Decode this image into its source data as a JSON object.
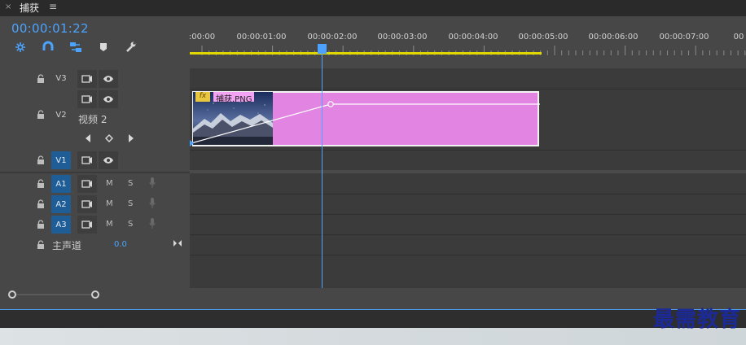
{
  "tab": {
    "close_glyph": "×",
    "title": "捕获",
    "menu_glyph": "≡"
  },
  "timecode": "00:00:01:22",
  "tools": [
    {
      "name": "insert-nest-icon"
    },
    {
      "name": "snap-icon"
    },
    {
      "name": "linked-selection-icon"
    },
    {
      "name": "add-marker-icon"
    },
    {
      "name": "wrench-settings-icon"
    }
  ],
  "ruler": {
    "labels": [
      ":00:00",
      "00:00:01:00",
      "00:00:02:00",
      "00:00:03:00",
      "00:00:04:00",
      "00:00:05:00",
      "00:00:06:00",
      "00:00:07:00",
      "00"
    ]
  },
  "tracks": {
    "v3": {
      "name": "V3"
    },
    "v2": {
      "name": "V2",
      "label": "视频 2"
    },
    "v1": {
      "name": "V1"
    },
    "a1": {
      "name": "A1",
      "m": "M",
      "s": "S"
    },
    "a2": {
      "name": "A2",
      "m": "M",
      "s": "S"
    },
    "a3": {
      "name": "A3",
      "m": "M",
      "s": "S"
    },
    "master": {
      "label": "主声道",
      "value": "0.0"
    }
  },
  "clip": {
    "fx": "fx",
    "name": "捕获.PNG"
  },
  "colors": {
    "accent": "#4ba3ff",
    "clip": "#e285e2",
    "workbar": "#e0d600",
    "source_patch": "#1f5d96"
  },
  "watermark": "最需教育"
}
